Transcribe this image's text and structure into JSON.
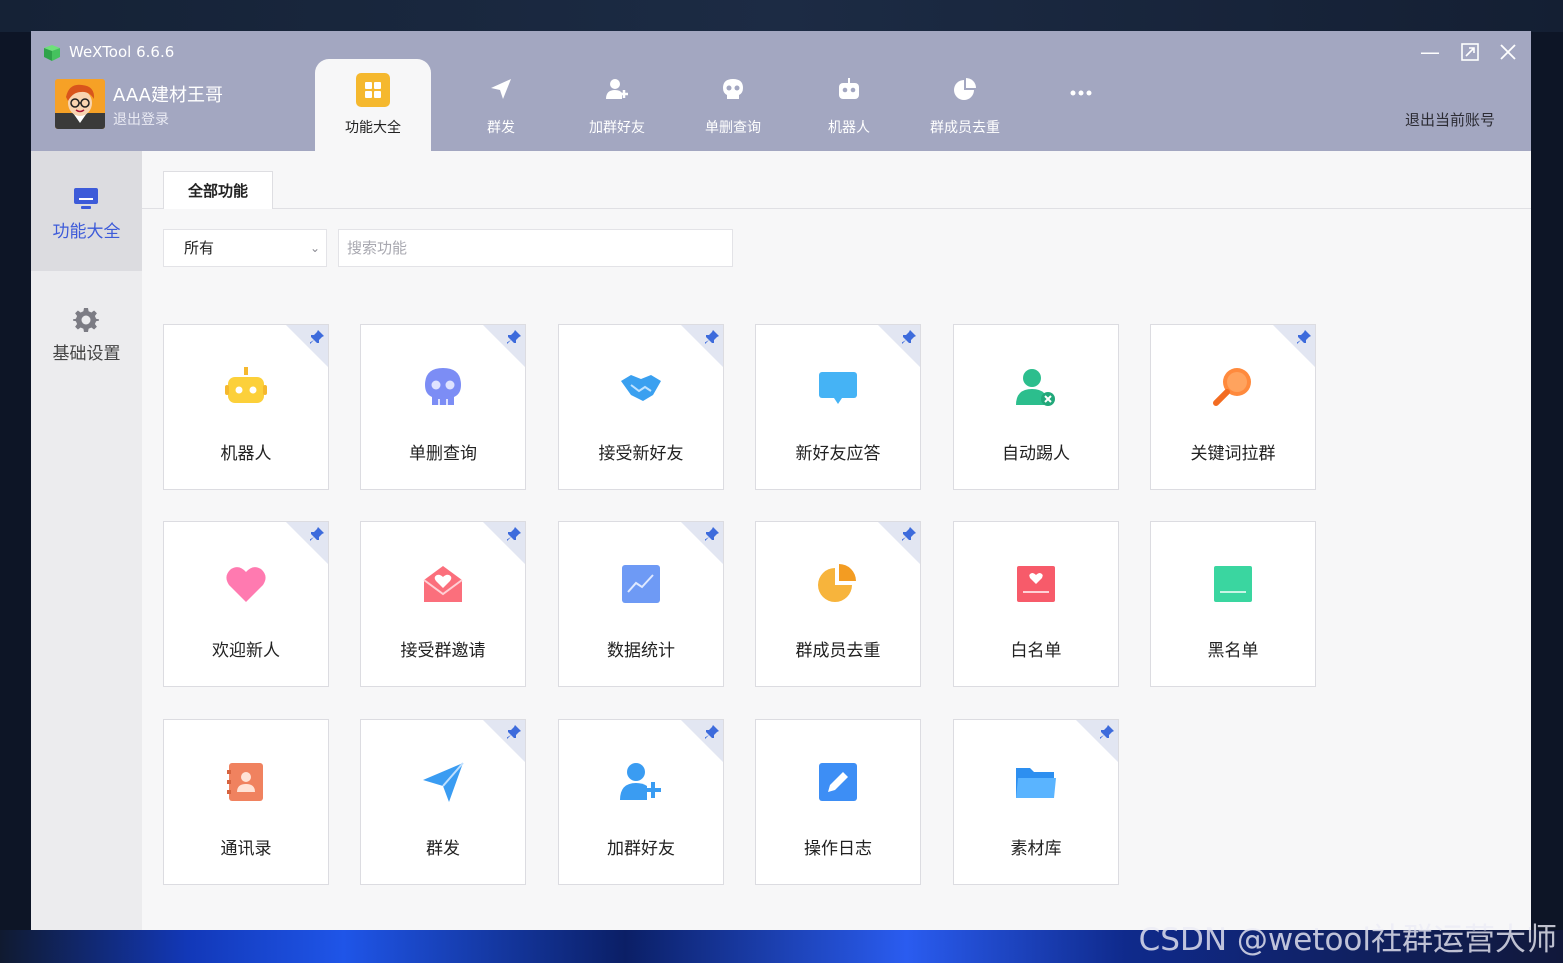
{
  "window": {
    "title": "WeXTool 6.6.6"
  },
  "user": {
    "name": "AAA建材王哥",
    "logout_label": "退出登录"
  },
  "top_tabs": [
    {
      "label": "功能大全",
      "icon": "grid-icon",
      "active": true
    },
    {
      "label": "群发",
      "icon": "paper-plane-icon"
    },
    {
      "label": "加群好友",
      "icon": "add-user-icon"
    },
    {
      "label": "单删查询",
      "icon": "skull-icon"
    },
    {
      "label": "机器人",
      "icon": "robot-icon"
    },
    {
      "label": "群成员去重",
      "icon": "pie-chart-icon"
    },
    {
      "label": "",
      "icon": "more-icon"
    }
  ],
  "switch_account_label": "退出当前账号",
  "sidebar": {
    "items": [
      {
        "label": "功能大全",
        "icon": "monitor-icon",
        "active": true
      },
      {
        "label": "基础设置",
        "icon": "gear-icon"
      }
    ]
  },
  "main": {
    "tab_label": "全部功能",
    "category": {
      "selected": "所有"
    },
    "search": {
      "placeholder": "搜索功能",
      "value": ""
    },
    "features": [
      {
        "label": "机器人",
        "icon": "robot-icon",
        "pinned": true
      },
      {
        "label": "单删查询",
        "icon": "skull-icon",
        "pinned": true
      },
      {
        "label": "接受新好友",
        "icon": "handshake-icon",
        "pinned": true
      },
      {
        "label": "新好友应答",
        "icon": "chat-bubble-icon",
        "pinned": true
      },
      {
        "label": "自动踢人",
        "icon": "user-remove-icon",
        "pinned": false
      },
      {
        "label": "关键词拉群",
        "icon": "magnifier-icon",
        "pinned": true
      },
      {
        "label": "欢迎新人",
        "icon": "heart-icon",
        "pinned": true
      },
      {
        "label": "接受群邀请",
        "icon": "envelope-icon",
        "pinned": true
      },
      {
        "label": "数据统计",
        "icon": "line-chart-icon",
        "pinned": true
      },
      {
        "label": "群成员去重",
        "icon": "pie-chart-icon",
        "pinned": true
      },
      {
        "label": "白名单",
        "icon": "whitelist-icon",
        "pinned": false
      },
      {
        "label": "黑名单",
        "icon": "blacklist-icon",
        "pinned": false
      },
      {
        "label": "通讯录",
        "icon": "contacts-icon",
        "pinned": false
      },
      {
        "label": "群发",
        "icon": "paper-plane-icon",
        "pinned": true
      },
      {
        "label": "加群好友",
        "icon": "add-user-icon",
        "pinned": true
      },
      {
        "label": "操作日志",
        "icon": "edit-log-icon",
        "pinned": false
      },
      {
        "label": "素材库",
        "icon": "folder-icon",
        "pinned": true
      }
    ]
  },
  "watermark": "CSDN @wetool社群运营大师",
  "colors": {
    "titlebar": "#a3a7c1",
    "accent_blue": "#3d5bd9",
    "active_tab_icon": "#f5b82e",
    "pin": "#3d6bdc"
  }
}
